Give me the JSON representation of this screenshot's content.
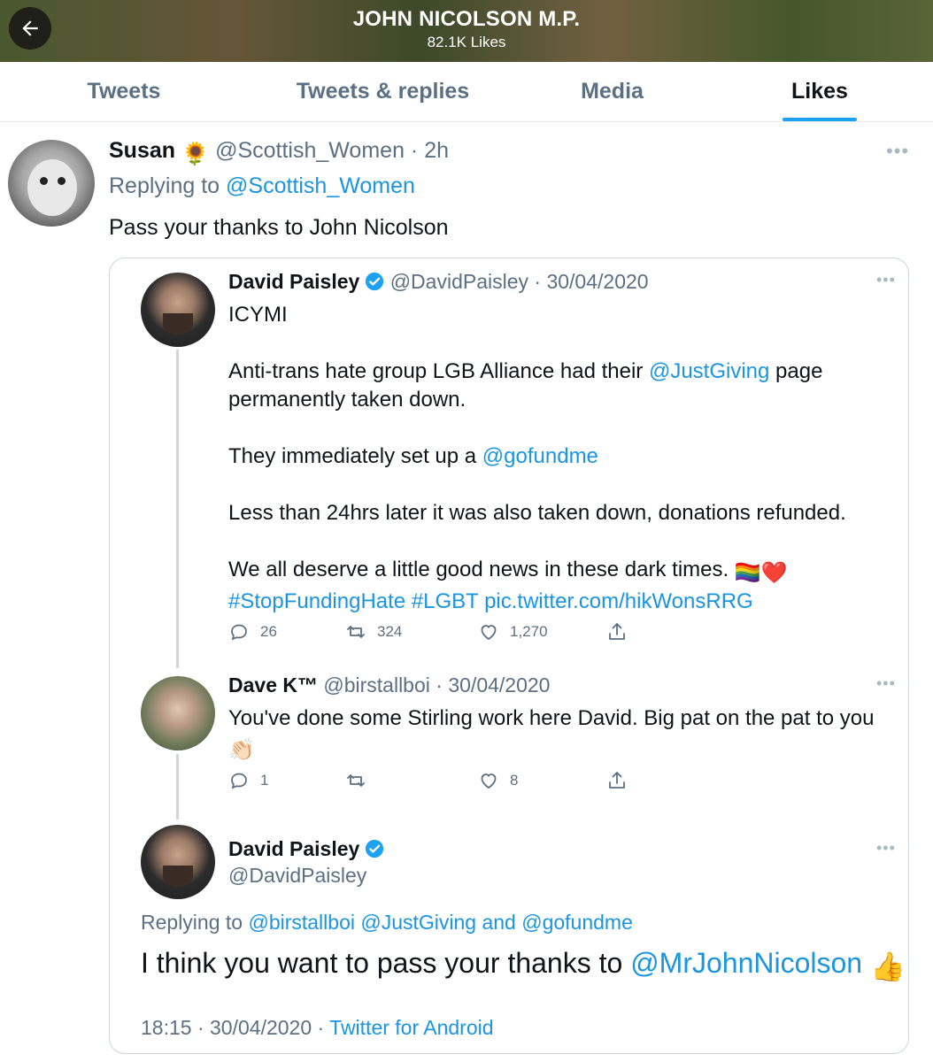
{
  "header": {
    "title": "JOHN NICOLSON M.P.",
    "subtitle": "82.1K Likes"
  },
  "tabs": [
    {
      "label": "Tweets"
    },
    {
      "label": "Tweets & replies"
    },
    {
      "label": "Media"
    },
    {
      "label": "Likes",
      "active": true
    }
  ],
  "tweet": {
    "name": "Susan",
    "name_emoji": "🌻",
    "handle": "@Scottish_Women",
    "time": "2h",
    "replying_prefix": "Replying to",
    "replying_to": "@Scottish_Women",
    "text": "Pass your thanks to John Nicolson"
  },
  "quoted": {
    "t1": {
      "name": "David Paisley",
      "handle": "@DavidPaisley",
      "date": "30/04/2020",
      "line1": "ICYMI",
      "p2_pre": "Anti-trans hate group LGB Alliance had their",
      "p2_link": "@JustGiving",
      "p2_post": "page",
      "p2_line2": "permanently taken down.",
      "p3_pre": "They immediately set up a",
      "p3_link": "@gofundme",
      "p4": "Less than 24hrs later it was also taken down, donations refunded.",
      "p5": "We all deserve a little good news in these dark times.",
      "p5_emoji": "🏳️‍🌈❤️",
      "hashtags": "#StopFundingHate #LGBT pic.twitter.com/hikWonsRRG",
      "replies": "26",
      "retweets": "324",
      "likes": "1,270"
    },
    "t2": {
      "name": "Dave K™",
      "handle": "@birstallboi",
      "date": "30/04/2020",
      "text": "You've done some Stirling work here David. Big pat on the pat to you",
      "emoji": "👏🏻",
      "replies": "1",
      "retweets": "",
      "likes": "8"
    },
    "t3": {
      "name": "David Paisley",
      "handle": "@DavidPaisley",
      "replying_prefix": "Replying to",
      "replying_to": "@birstallboi @JustGiving and @gofundme",
      "text_pre": "I think you want to pass your thanks to",
      "text_link": "@MrJohnNicolson",
      "emoji": "👍",
      "time": "18:15",
      "date": "30/04/2020",
      "source": "Twitter for Android"
    }
  },
  "colors": {
    "accent": "#1da1f2",
    "link": "#1b95e0",
    "muted": "#5b7083",
    "border": "#ccd6dd"
  },
  "icons": [
    "back-arrow-icon",
    "more-icon",
    "reply-icon",
    "retweet-icon",
    "like-icon",
    "share-icon",
    "verified-badge-icon"
  ]
}
